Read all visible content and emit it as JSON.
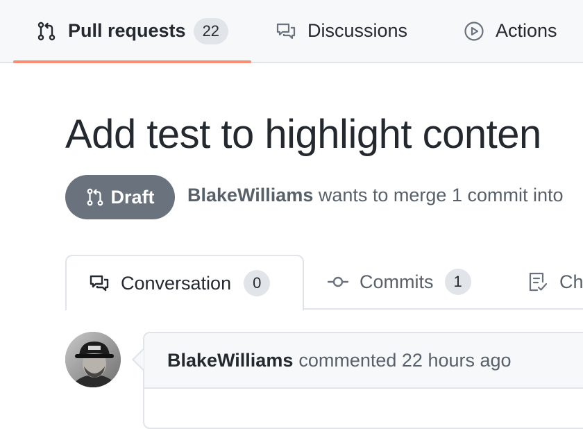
{
  "repo_nav": {
    "items": [
      {
        "label": "Pull requests",
        "count": "22",
        "icon": "git-pull-request-icon",
        "selected": true
      },
      {
        "label": "Discussions",
        "icon": "comment-discussion-icon",
        "selected": false
      },
      {
        "label": "Actions",
        "icon": "play-icon",
        "selected": false
      }
    ]
  },
  "pr": {
    "title": "Add test to highlight conten",
    "state": "Draft",
    "author": "BlakeWilliams",
    "meta_text": "wants to merge 1 commit into"
  },
  "tabs": [
    {
      "label": "Conversation",
      "count": "0",
      "icon": "comment-discussion-icon",
      "selected": true
    },
    {
      "label": "Commits",
      "count": "1",
      "icon": "git-commit-icon",
      "selected": false
    },
    {
      "label": "Ch",
      "icon": "file-diff-icon",
      "selected": false
    }
  ],
  "comment": {
    "author": "BlakeWilliams",
    "action_text": "commented 22 hours ago"
  },
  "colors": {
    "nav_background": "#f6f8fa",
    "selected_underline": "#fd8c73",
    "draft_badge": "#6a737d",
    "border": "#e1e4e8",
    "counter_background": "#e1e4e8",
    "muted_text": "#586069",
    "text": "#24292f"
  }
}
